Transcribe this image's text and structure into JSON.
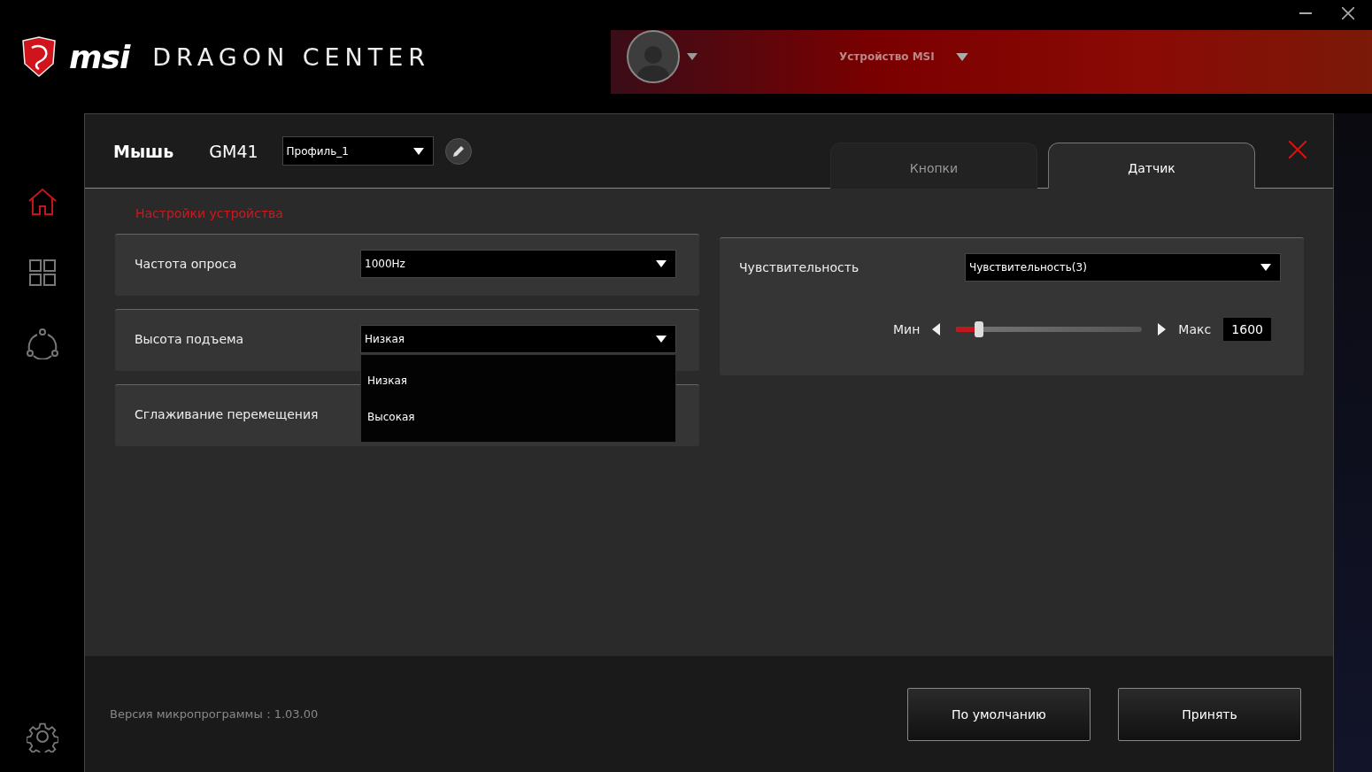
{
  "app": {
    "brand": "msi",
    "title": "DRAGON CENTER",
    "device_menu": "Устройство MSI"
  },
  "sidebar": {
    "items": [
      {
        "kind": "home",
        "selected": true
      },
      {
        "kind": "apps",
        "selected": false
      },
      {
        "kind": "share",
        "selected": false
      }
    ]
  },
  "dialog": {
    "title": "Мышь",
    "model": "GM41",
    "profile": "Профиль_1",
    "tabs": [
      {
        "label": "Кнопки",
        "selected": false
      },
      {
        "label": "Датчик",
        "selected": true
      }
    ],
    "section_title": "Настройки устройства",
    "left_rows": [
      {
        "label": "Частота опроса",
        "value": "1000Hz",
        "open": false
      },
      {
        "label": "Высота подъема",
        "value": "Низкая",
        "open": true,
        "options": [
          "Низкая",
          "Высокая"
        ]
      },
      {
        "label": "Сглаживание перемещения",
        "open": false
      }
    ],
    "sensitivity": {
      "label": "Чувствительность",
      "value": "Чувствительность(3)",
      "min_label": "Мин",
      "max_label": "Макс",
      "level": 0.1,
      "reading": "1600"
    },
    "firmware": "Версия микропрограммы：1.03.00",
    "buttons": [
      "По умолчанию",
      "Принять"
    ]
  }
}
